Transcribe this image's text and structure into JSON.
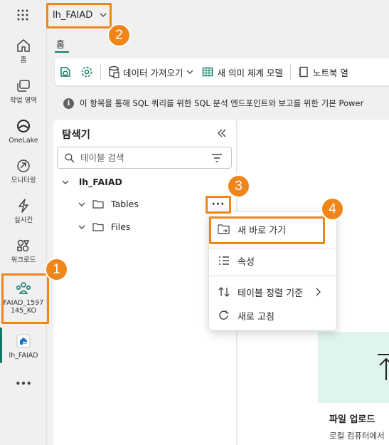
{
  "header": {
    "workspace_name": "lh_FAIAD"
  },
  "rail": {
    "items": [
      {
        "label": "홈",
        "icon": "home-icon"
      },
      {
        "label": "작업 영역",
        "icon": "workspaces-icon"
      },
      {
        "label": "OneLake",
        "icon": "onelake-icon"
      },
      {
        "label": "모니터링",
        "icon": "monitor-icon"
      },
      {
        "label": "실시간",
        "icon": "realtime-icon"
      },
      {
        "label": "워크로드",
        "icon": "workloads-icon"
      },
      {
        "label": "FAIAD_1597\n145_KO",
        "label_line1": "FAIAD_1597",
        "label_line2": "145_KO",
        "icon": "workspace-people-icon"
      },
      {
        "label": "lh_FAIAD",
        "icon": "lakehouse-icon"
      }
    ],
    "more": "•••"
  },
  "ribbon": {
    "tab": "홈",
    "buttons": [
      {
        "label": "데이터 가져오기",
        "icon": "database-icon"
      },
      {
        "label": "새 의미 체계 모델",
        "icon": "table-icon"
      },
      {
        "label": "노트북 열",
        "icon": "notebook-icon"
      }
    ]
  },
  "info_bar": {
    "text": "이 항목을 통해 SQL 쿼리를 위한 SQL 분석 엔드포인트와 보고를 위한 기본 Power"
  },
  "explorer": {
    "title": "탐색기",
    "search_placeholder": "테이블 검색",
    "tree": {
      "root": "lh_FAIAD",
      "children": [
        "Tables",
        "Files"
      ]
    },
    "more_label": "···"
  },
  "context_menu": {
    "items": [
      {
        "label": "새 바로 가기",
        "icon": "folder-link-icon"
      },
      {
        "label": "속성",
        "icon": "properties-icon"
      },
      {
        "label": "테이블 정렬 기준",
        "icon": "sort-icon",
        "submenu": true
      },
      {
        "label": "새로 고침",
        "icon": "refresh-icon"
      }
    ]
  },
  "main": {
    "upload_title": "파일 업로드",
    "upload_subtitle": "로컬 컴퓨터에서"
  },
  "callouts": [
    "1",
    "2",
    "3",
    "4"
  ],
  "colors": {
    "accent": "#117865",
    "callout": "#f0861a",
    "upload_tile": "#dff5ec"
  }
}
